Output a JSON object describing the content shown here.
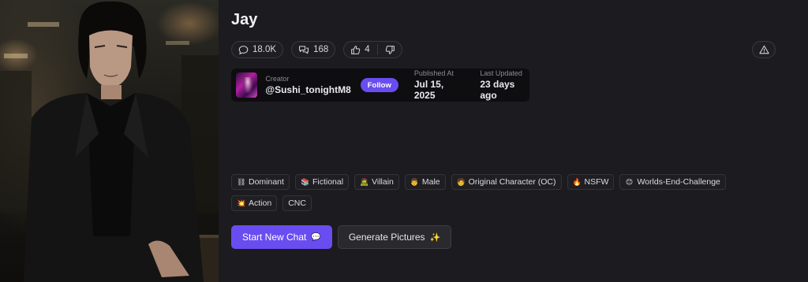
{
  "character": {
    "name": "Jay"
  },
  "stats": {
    "views": "18.0K",
    "chats": "168",
    "likes": "4"
  },
  "creator": {
    "label": "Creator",
    "handle": "@Sushi_tonightM8",
    "follow_label": "Follow",
    "published_label": "Published At",
    "published_value": "Jul 15, 2025",
    "updated_label": "Last Updated",
    "updated_value": "23 days ago"
  },
  "tags": [
    {
      "icon": "⛓",
      "label": "Dominant"
    },
    {
      "icon": "📚",
      "label": "Fictional"
    },
    {
      "icon": "🧟",
      "label": "Villain"
    },
    {
      "icon": "👨",
      "label": "Male"
    },
    {
      "icon": "🧑",
      "label": "Original Character (OC)"
    },
    {
      "icon": "🔥",
      "label": "NSFW"
    },
    {
      "icon": "😊",
      "label": "Worlds-End-Challenge"
    },
    {
      "icon": "💥",
      "label": "Action"
    },
    {
      "icon": "",
      "label": "CNC"
    }
  ],
  "actions": {
    "start_chat_label": "Start New Chat",
    "start_chat_icon": "💬",
    "generate_label": "Generate Pictures",
    "generate_icon": "✨"
  },
  "colors": {
    "accent": "#6a4df0",
    "background": "#1c1b1f"
  }
}
